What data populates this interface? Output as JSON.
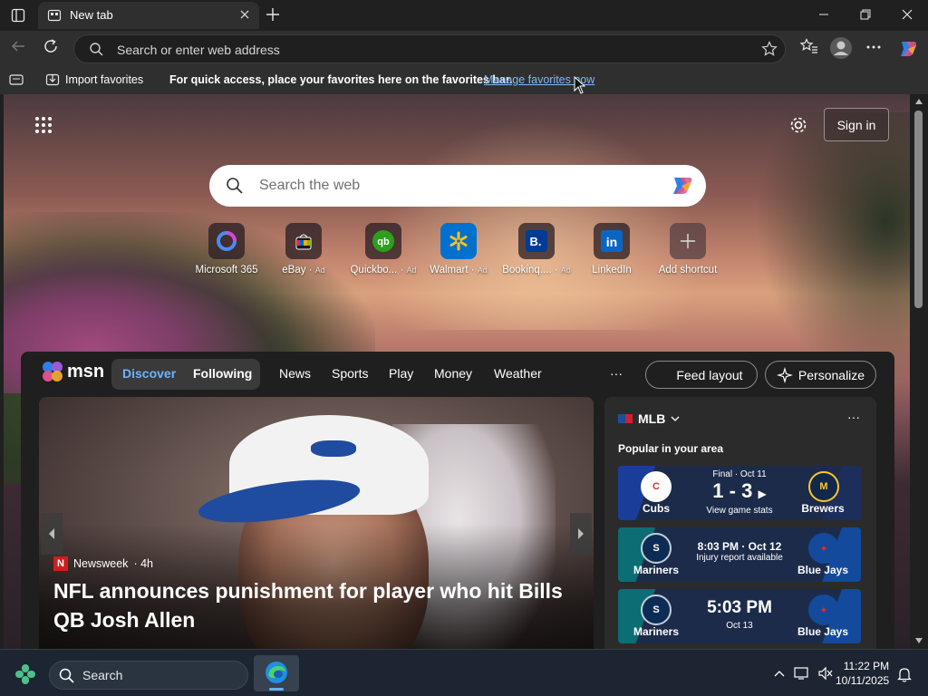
{
  "browser": {
    "tab": {
      "title": "New tab"
    },
    "address_bar": {
      "placeholder": "Search or enter web address"
    },
    "favorites_bar": {
      "import": "Import favorites",
      "message": "For quick access, place your favorites here on the favorites bar.",
      "manage_link": "Manage favorites now"
    }
  },
  "newtab": {
    "sign_in": "Sign in",
    "search_placeholder": "Search the web",
    "quick_links": [
      {
        "label": "Microsoft 365",
        "ad": "",
        "icon": "microsoft365-icon"
      },
      {
        "label": "eBay",
        "ad": "Ad",
        "icon": "ebay-icon"
      },
      {
        "label": "Quickbo...",
        "ad": "Ad",
        "icon": "quickbooks-icon"
      },
      {
        "label": "Walmart",
        "ad": "Ad",
        "icon": "walmart-icon"
      },
      {
        "label": "Bookinq....",
        "ad": "Ad",
        "icon": "booking-icon"
      },
      {
        "label": "LinkedIn",
        "ad": "",
        "icon": "linkedin-icon"
      },
      {
        "label": "Add shortcut",
        "ad": "",
        "icon": "plus-icon"
      }
    ]
  },
  "feed": {
    "logo": "msn",
    "tabs": [
      "Discover",
      "Following"
    ],
    "nav": [
      "News",
      "Sports",
      "Play",
      "Money",
      "Weather"
    ],
    "more": "···",
    "feed_layout": "Feed layout",
    "personalize": "Personalize",
    "hero": {
      "source": "Newsweek",
      "age": "· 4h",
      "headline": "NFL announces punishment for player who hit Bills QB Josh Allen"
    },
    "sports": {
      "league": "MLB",
      "more": "···",
      "subtitle": "Popular in your area",
      "games": [
        {
          "home": "Cubs",
          "away": "Brewers",
          "status": "Final · Oct 11",
          "score": "1 - 3",
          "note": "View game stats"
        },
        {
          "home": "Mariners",
          "away": "Blue Jays",
          "status": "8:03 PM · Oct 12",
          "score": "",
          "note": "Injury report available"
        },
        {
          "home": "Mariners",
          "away": "Blue Jays",
          "status": "",
          "score": "5:03 PM",
          "note": "Oct 13"
        }
      ]
    }
  },
  "taskbar": {
    "search": "Search",
    "time": "11:22 PM",
    "date": "10/11/2025"
  },
  "colors": {
    "accent": "#6cb4ff",
    "link": "#7fb8ff",
    "taskbar": "#1c2531"
  }
}
